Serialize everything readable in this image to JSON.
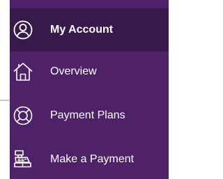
{
  "colors": {
    "menu_background": "#4f2169",
    "active_background": "#37194c",
    "text": "#ffffff",
    "gutter_line": "#c9c9c9"
  },
  "menu": {
    "items": [
      {
        "label": "My Account",
        "icon": "user-circle-icon",
        "active": true
      },
      {
        "label": "Overview",
        "icon": "house-icon",
        "active": false
      },
      {
        "label": "Payment Plans",
        "icon": "lifebuoy-icon",
        "active": false
      },
      {
        "label": "Make a Payment",
        "icon": "cash-register-icon",
        "active": false
      }
    ]
  }
}
